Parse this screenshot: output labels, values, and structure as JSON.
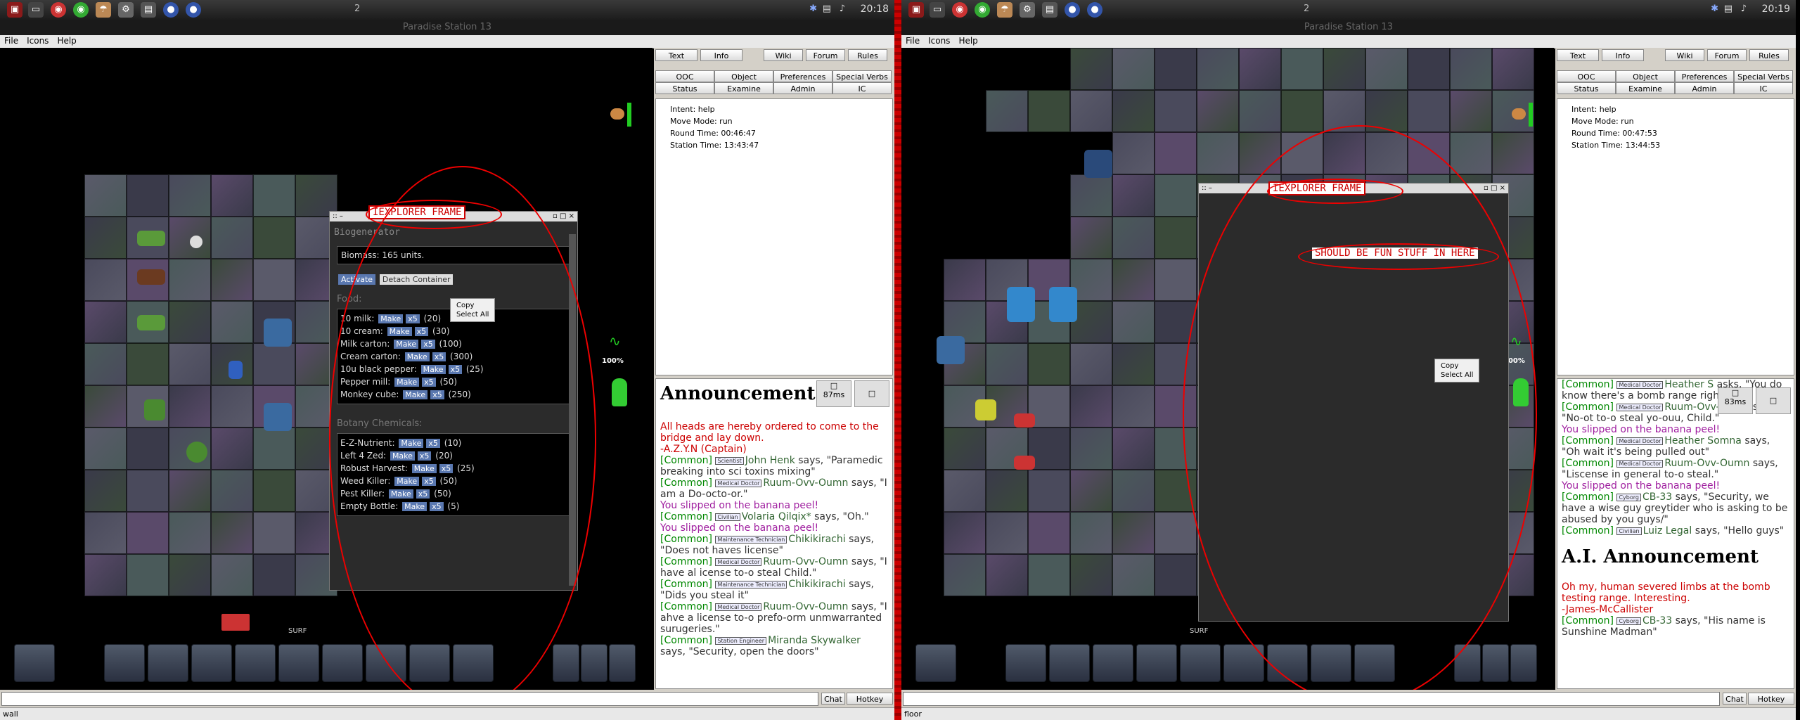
{
  "taskbar": {
    "left_workspace": "2",
    "right_workspace": "2",
    "left_clock": "20:18",
    "right_clock": "20:19"
  },
  "window": {
    "title": "Paradise Station 13"
  },
  "menu": {
    "file": "File",
    "icons": "Icons",
    "help": "Help"
  },
  "tabs": {
    "row1": [
      "Text",
      "Info",
      "Wiki",
      "Forum",
      "Rules"
    ],
    "row2": [
      "OOC",
      "Object",
      "Preferences",
      "Special Verbs"
    ],
    "row3": [
      "Status",
      "Examine",
      "Admin",
      "IC"
    ]
  },
  "left_status": {
    "intent": "Intent: help",
    "move_mode": "Move Mode: run",
    "round_time": "Round Time: 00:46:47",
    "station_time": "Station Time: 13:43:47"
  },
  "right_status": {
    "intent": "Intent: help",
    "move_mode": "Move Mode: run",
    "round_time": "Round Time: 00:47:53",
    "station_time": "Station Time: 13:44:53"
  },
  "hud": {
    "health_pct": "100%",
    "surf": "SURF"
  },
  "left_ping": "87ms",
  "right_ping": "83ms",
  "iexplorer_label": "IEXPLORER FRAME",
  "fun_label": "SHOULD BE FUN STUFF IN HERE",
  "context_menu": {
    "copy": "Copy",
    "select_all": "Select All"
  },
  "biogen": {
    "title": "Biogenerator",
    "biomass": "Biomass: 165 units.",
    "activate": "Activate",
    "detach": "Detach Container",
    "food_head": "Food:",
    "food": [
      {
        "name": "10 milk:",
        "cost": "(20)"
      },
      {
        "name": "10 cream:",
        "cost": "(30)"
      },
      {
        "name": "Milk carton:",
        "cost": "(100)"
      },
      {
        "name": "Cream carton:",
        "cost": "(300)"
      },
      {
        "name": "10u black pepper:",
        "cost": "(25)"
      },
      {
        "name": "Pepper mill:",
        "cost": "(50)"
      },
      {
        "name": "Monkey cube:",
        "cost": "(250)"
      }
    ],
    "botany_head": "Botany Chemicals:",
    "botany": [
      {
        "name": "E-Z-Nutrient:",
        "cost": "(10)"
      },
      {
        "name": "Left 4 Zed:",
        "cost": "(20)"
      },
      {
        "name": "Robust Harvest:",
        "cost": "(25)"
      },
      {
        "name": "Weed Killer:",
        "cost": "(50)"
      },
      {
        "name": "Pest Killer:",
        "cost": "(50)"
      },
      {
        "name": "Empty Bottle:",
        "cost": "(5)"
      }
    ],
    "make": "Make",
    "x5": "x5"
  },
  "left_chat": {
    "announce_title": "Announcement",
    "announce_text": "All heads are hereby ordered to come to the bridge and lay down.",
    "announce_sig": "-A.Z.Y.N (Captain)",
    "lines": [
      {
        "ch": "[Common]",
        "job": "Scientist",
        "who": "John Henk",
        "msg": "says, \"Paramedic breaking into sci toxins mixing\""
      },
      {
        "ch": "[Common]",
        "job": "Medical Doctor",
        "who": "Ruum-Ovv-Oumn",
        "msg": "says, \"I am a Do-octo-or.\""
      },
      {
        "ch": "",
        "job": "",
        "who": "",
        "msg": "You slipped on the banana peel!"
      },
      {
        "ch": "[Common]",
        "job": "Civilian",
        "who": "Volaria Qilqix*",
        "msg": "says, \"Oh.\""
      },
      {
        "ch": "",
        "job": "",
        "who": "",
        "msg": "You slipped on the banana peel!"
      },
      {
        "ch": "[Common]",
        "job": "Maintenance Technician",
        "who": "Chikikirachi",
        "msg": "says, \"Does not haves license\""
      },
      {
        "ch": "[Common]",
        "job": "Medical Doctor",
        "who": "Ruum-Ovv-Oumn",
        "msg": "says, \"I have al icense to-o steal Child.\""
      },
      {
        "ch": "[Common]",
        "job": "Maintenance Technician",
        "who": "Chikikirachi",
        "msg": "says, \"Dids you steal it\""
      },
      {
        "ch": "[Common]",
        "job": "Medical Doctor",
        "who": "Ruum-Ovv-Oumn",
        "msg": "says, \"I ahve a license to-o prefo-orm unmwarranted surugeries.\""
      },
      {
        "ch": "[Common]",
        "job": "Station Engineer",
        "who": "Miranda Skywalker",
        "msg": "says, \"Security, open the doors\""
      }
    ]
  },
  "right_chat": {
    "lines": [
      {
        "ch": "[Common]",
        "job": "Medical Doctor",
        "who": "Heather S",
        "msg": "asks, \"You do know there's a bomb range right?\""
      },
      {
        "ch": "[Common]",
        "job": "Medical Doctor",
        "who": "Ruum-Ovv-Oumn",
        "msg": "says, \"No-ot to-o steal yo-ouu, Child.\""
      },
      {
        "ch": "",
        "job": "",
        "who": "",
        "msg": "You slipped on the banana peel!"
      },
      {
        "ch": "[Common]",
        "job": "Medical Doctor",
        "who": "Heather Somna",
        "msg": "says, \"Oh wait it's being pulled out\""
      },
      {
        "ch": "[Common]",
        "job": "Medical Doctor",
        "who": "Ruum-Ovv-Oumn",
        "msg": "says, \"Liscense in general to-o steal.\""
      },
      {
        "ch": "",
        "job": "",
        "who": "",
        "msg": "You slipped on the banana peel!"
      },
      {
        "ch": "[Common]",
        "job": "Cyborg",
        "who": "CB-33",
        "msg": "says, \"Security, we have a wise guy greytider who is asking to be abused by you guys/\""
      },
      {
        "ch": "[Common]",
        "job": "Civilian",
        "who": "Luiz Legal",
        "msg": "says, \"Hello guys\""
      }
    ],
    "ai_title": "A.I. Announcement",
    "ai_text": "Oh my, human severed limbs at the bomb testing range. Interesting.",
    "ai_sig": "-James-McCallister",
    "last": {
      "ch": "[Common]",
      "job": "Cyborg",
      "who": "CB-33",
      "msg": "says, \"His name is Sunshine Madman\""
    }
  },
  "bottom": {
    "chat": "Chat",
    "hotkey": "Hotkey Toggle",
    "left_status": "wall",
    "right_status": "floor"
  },
  "colors": {
    "accent": "#cc0000",
    "make_button": "#5a78b0"
  }
}
